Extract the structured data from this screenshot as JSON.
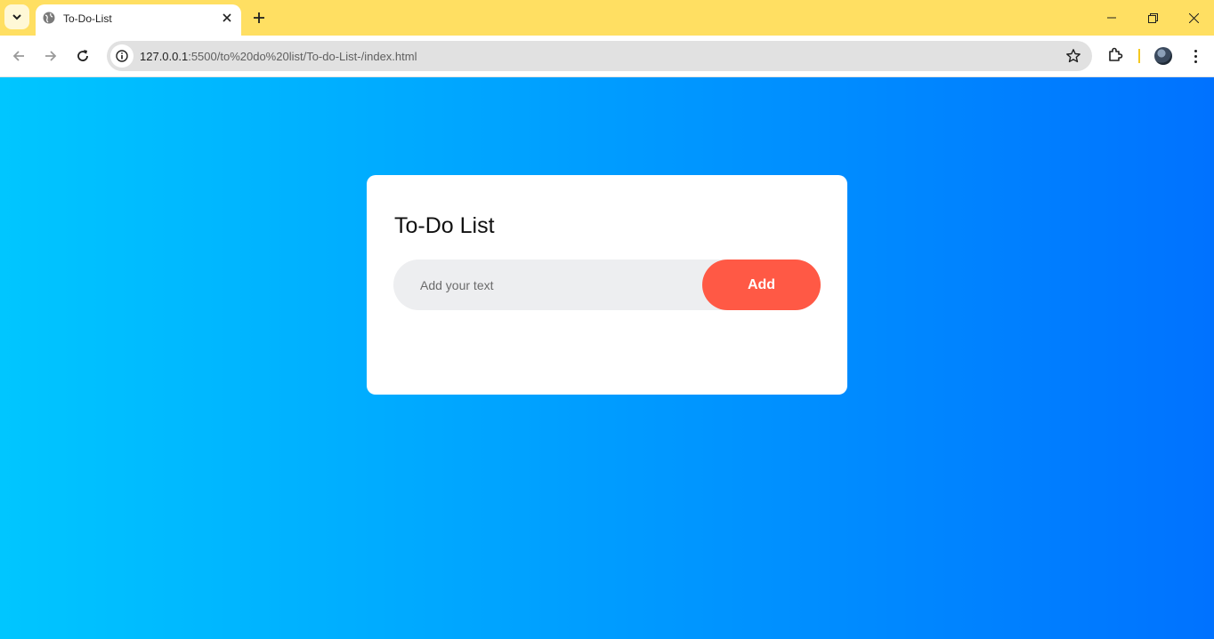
{
  "browser": {
    "tab": {
      "title": "To-Do-List"
    },
    "address": {
      "host": "127.0.0.1",
      "path": ":5500/to%20do%20list/To-do-List-/index.html"
    }
  },
  "page": {
    "title": "To-Do List",
    "input": {
      "placeholder": "Add your text",
      "value": ""
    },
    "add_button_label": "Add"
  },
  "colors": {
    "tabstrip": "#ffdf62",
    "gradient_start": "#00c6ff",
    "gradient_end": "#0072ff",
    "add_button": "#ff5945",
    "input_bg": "#edeef0"
  },
  "icons": [
    "tab-search-icon",
    "globe-icon",
    "close-icon",
    "plus-icon",
    "minimize-icon",
    "restore-icon",
    "window-close-icon",
    "back-arrow-icon",
    "forward-arrow-icon",
    "reload-icon",
    "info-icon",
    "star-icon",
    "puzzle-icon",
    "profile-avatar",
    "kebab-menu-icon"
  ]
}
